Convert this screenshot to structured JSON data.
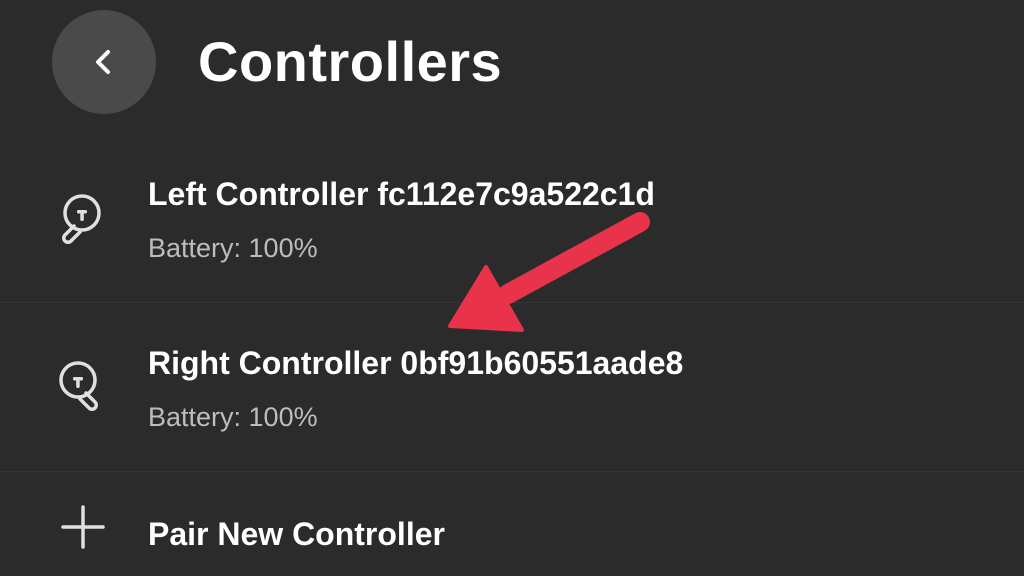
{
  "header": {
    "title": "Controllers",
    "back_icon": "chevron-left-icon"
  },
  "controllers": [
    {
      "name": "Left Controller fc112e7c9a522c1d",
      "battery": "Battery: 100%",
      "icon": "controller-icon"
    },
    {
      "name": "Right Controller 0bf91b60551aade8",
      "battery": "Battery: 100%",
      "icon": "controller-icon"
    }
  ],
  "pair_action": {
    "label": "Pair New Controller",
    "icon": "plus-icon"
  },
  "colors": {
    "background": "#2b2b2b",
    "back_button": "#4a4a4a",
    "subtitle": "#bdbdbd",
    "annotation_arrow": "#e8334a"
  }
}
